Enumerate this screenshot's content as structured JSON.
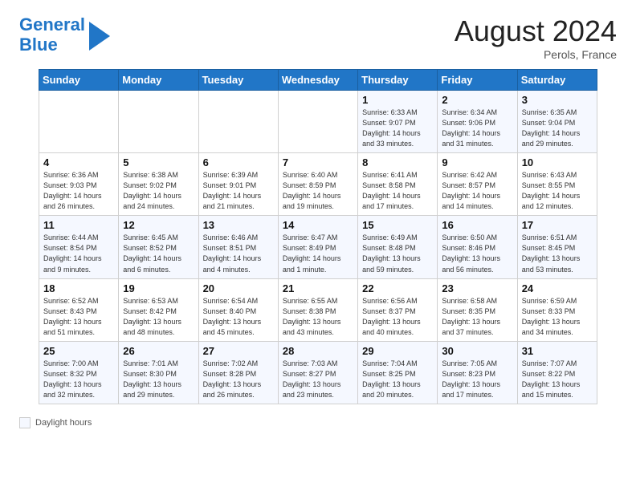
{
  "header": {
    "logo_line1": "General",
    "logo_line2": "Blue",
    "month": "August 2024",
    "location": "Perols, France"
  },
  "days_of_week": [
    "Sunday",
    "Monday",
    "Tuesday",
    "Wednesday",
    "Thursday",
    "Friday",
    "Saturday"
  ],
  "weeks": [
    [
      {
        "day": "",
        "info": ""
      },
      {
        "day": "",
        "info": ""
      },
      {
        "day": "",
        "info": ""
      },
      {
        "day": "",
        "info": ""
      },
      {
        "day": "1",
        "info": "Sunrise: 6:33 AM\nSunset: 9:07 PM\nDaylight: 14 hours\nand 33 minutes."
      },
      {
        "day": "2",
        "info": "Sunrise: 6:34 AM\nSunset: 9:06 PM\nDaylight: 14 hours\nand 31 minutes."
      },
      {
        "day": "3",
        "info": "Sunrise: 6:35 AM\nSunset: 9:04 PM\nDaylight: 14 hours\nand 29 minutes."
      }
    ],
    [
      {
        "day": "4",
        "info": "Sunrise: 6:36 AM\nSunset: 9:03 PM\nDaylight: 14 hours\nand 26 minutes."
      },
      {
        "day": "5",
        "info": "Sunrise: 6:38 AM\nSunset: 9:02 PM\nDaylight: 14 hours\nand 24 minutes."
      },
      {
        "day": "6",
        "info": "Sunrise: 6:39 AM\nSunset: 9:01 PM\nDaylight: 14 hours\nand 21 minutes."
      },
      {
        "day": "7",
        "info": "Sunrise: 6:40 AM\nSunset: 8:59 PM\nDaylight: 14 hours\nand 19 minutes."
      },
      {
        "day": "8",
        "info": "Sunrise: 6:41 AM\nSunset: 8:58 PM\nDaylight: 14 hours\nand 17 minutes."
      },
      {
        "day": "9",
        "info": "Sunrise: 6:42 AM\nSunset: 8:57 PM\nDaylight: 14 hours\nand 14 minutes."
      },
      {
        "day": "10",
        "info": "Sunrise: 6:43 AM\nSunset: 8:55 PM\nDaylight: 14 hours\nand 12 minutes."
      }
    ],
    [
      {
        "day": "11",
        "info": "Sunrise: 6:44 AM\nSunset: 8:54 PM\nDaylight: 14 hours\nand 9 minutes."
      },
      {
        "day": "12",
        "info": "Sunrise: 6:45 AM\nSunset: 8:52 PM\nDaylight: 14 hours\nand 6 minutes."
      },
      {
        "day": "13",
        "info": "Sunrise: 6:46 AM\nSunset: 8:51 PM\nDaylight: 14 hours\nand 4 minutes."
      },
      {
        "day": "14",
        "info": "Sunrise: 6:47 AM\nSunset: 8:49 PM\nDaylight: 14 hours\nand 1 minute."
      },
      {
        "day": "15",
        "info": "Sunrise: 6:49 AM\nSunset: 8:48 PM\nDaylight: 13 hours\nand 59 minutes."
      },
      {
        "day": "16",
        "info": "Sunrise: 6:50 AM\nSunset: 8:46 PM\nDaylight: 13 hours\nand 56 minutes."
      },
      {
        "day": "17",
        "info": "Sunrise: 6:51 AM\nSunset: 8:45 PM\nDaylight: 13 hours\nand 53 minutes."
      }
    ],
    [
      {
        "day": "18",
        "info": "Sunrise: 6:52 AM\nSunset: 8:43 PM\nDaylight: 13 hours\nand 51 minutes."
      },
      {
        "day": "19",
        "info": "Sunrise: 6:53 AM\nSunset: 8:42 PM\nDaylight: 13 hours\nand 48 minutes."
      },
      {
        "day": "20",
        "info": "Sunrise: 6:54 AM\nSunset: 8:40 PM\nDaylight: 13 hours\nand 45 minutes."
      },
      {
        "day": "21",
        "info": "Sunrise: 6:55 AM\nSunset: 8:38 PM\nDaylight: 13 hours\nand 43 minutes."
      },
      {
        "day": "22",
        "info": "Sunrise: 6:56 AM\nSunset: 8:37 PM\nDaylight: 13 hours\nand 40 minutes."
      },
      {
        "day": "23",
        "info": "Sunrise: 6:58 AM\nSunset: 8:35 PM\nDaylight: 13 hours\nand 37 minutes."
      },
      {
        "day": "24",
        "info": "Sunrise: 6:59 AM\nSunset: 8:33 PM\nDaylight: 13 hours\nand 34 minutes."
      }
    ],
    [
      {
        "day": "25",
        "info": "Sunrise: 7:00 AM\nSunset: 8:32 PM\nDaylight: 13 hours\nand 32 minutes."
      },
      {
        "day": "26",
        "info": "Sunrise: 7:01 AM\nSunset: 8:30 PM\nDaylight: 13 hours\nand 29 minutes."
      },
      {
        "day": "27",
        "info": "Sunrise: 7:02 AM\nSunset: 8:28 PM\nDaylight: 13 hours\nand 26 minutes."
      },
      {
        "day": "28",
        "info": "Sunrise: 7:03 AM\nSunset: 8:27 PM\nDaylight: 13 hours\nand 23 minutes."
      },
      {
        "day": "29",
        "info": "Sunrise: 7:04 AM\nSunset: 8:25 PM\nDaylight: 13 hours\nand 20 minutes."
      },
      {
        "day": "30",
        "info": "Sunrise: 7:05 AM\nSunset: 8:23 PM\nDaylight: 13 hours\nand 17 minutes."
      },
      {
        "day": "31",
        "info": "Sunrise: 7:07 AM\nSunset: 8:22 PM\nDaylight: 13 hours\nand 15 minutes."
      }
    ]
  ],
  "legend": {
    "label": "Daylight hours"
  }
}
